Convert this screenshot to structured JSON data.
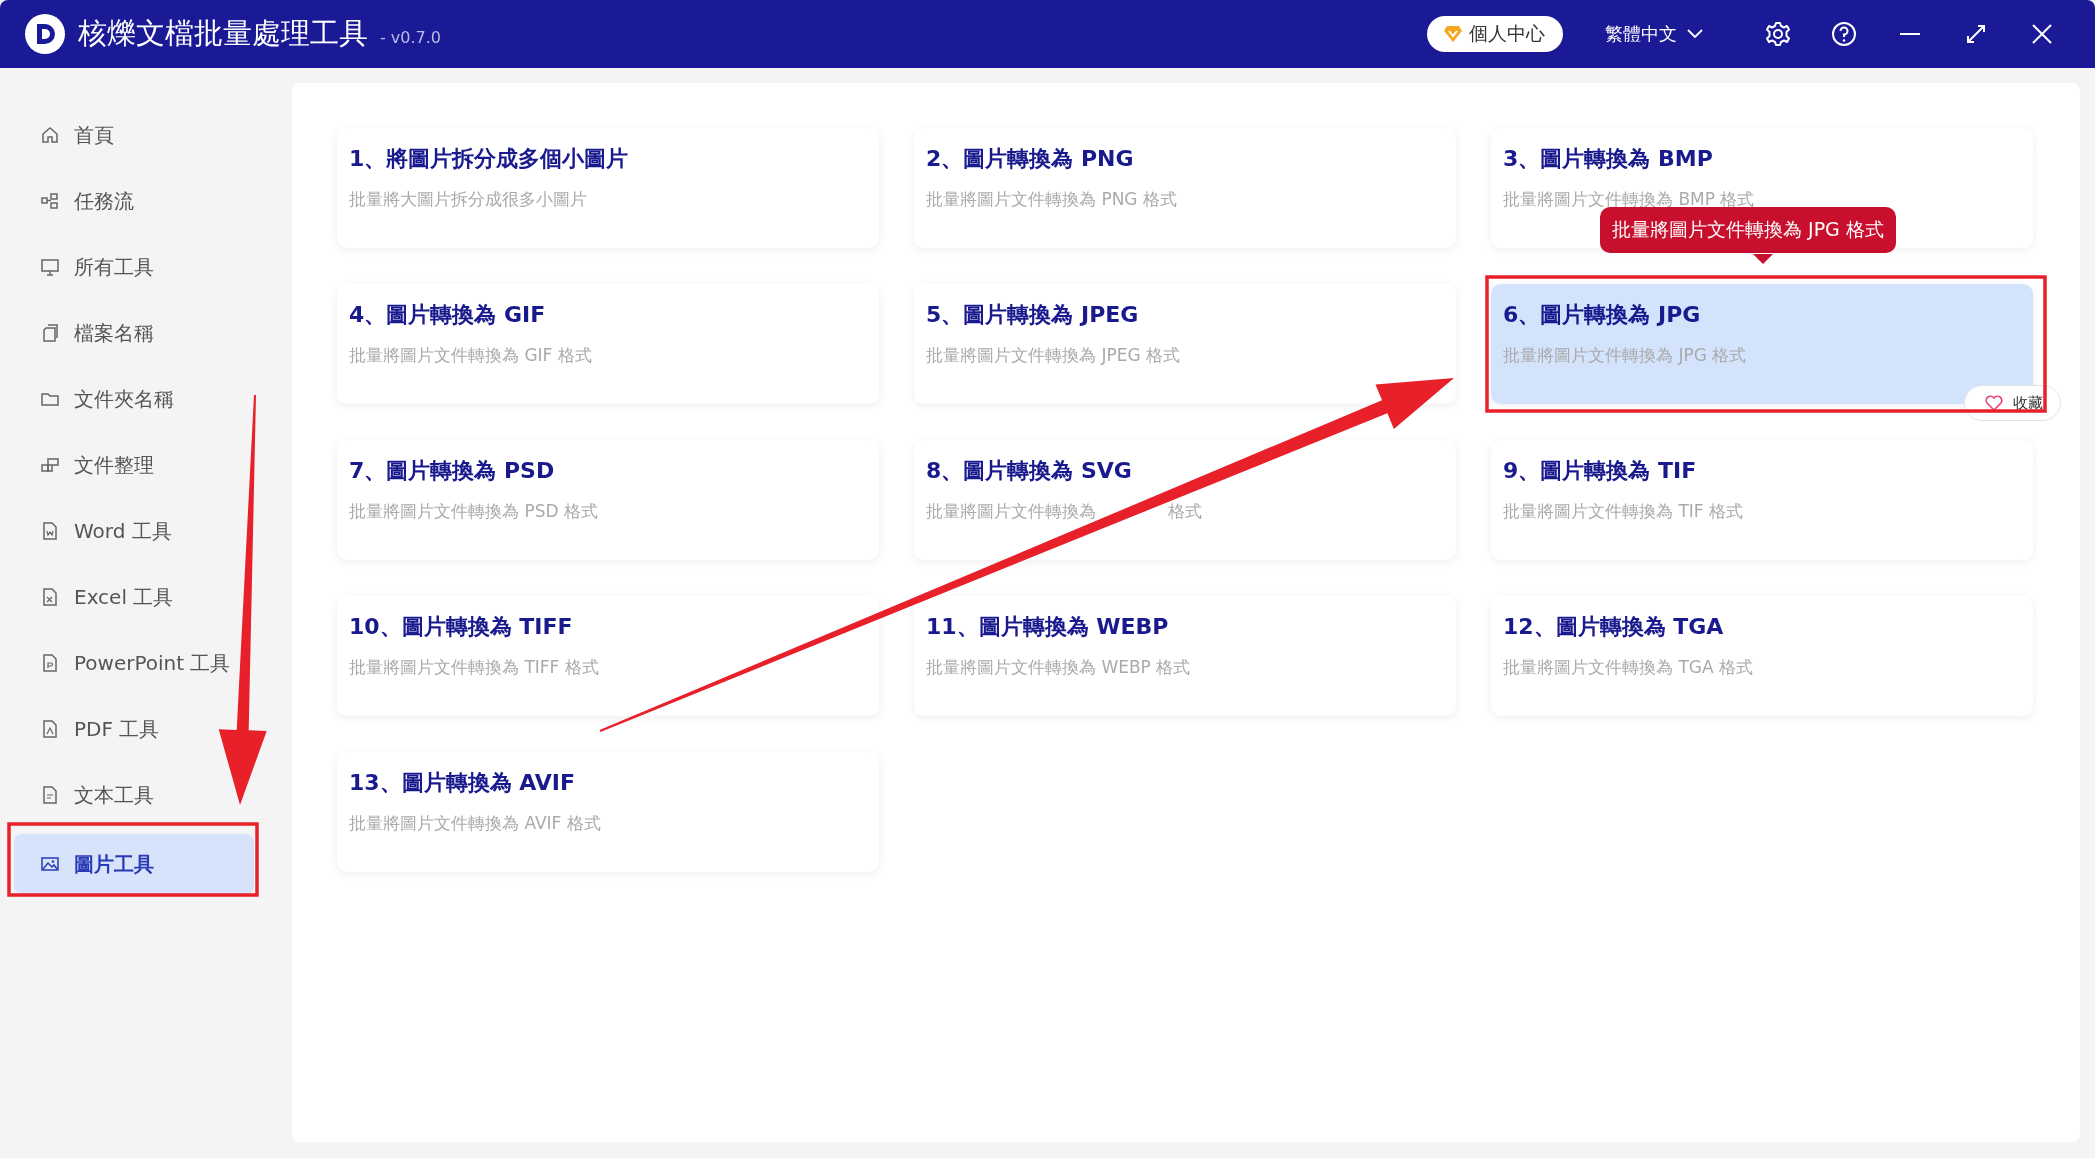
{
  "window": {
    "title": "核爍文檔批量處理工具",
    "version": "- v0.7.0",
    "account_button": "個人中心",
    "language": "繁體中文"
  },
  "sidebar": {
    "items": [
      {
        "label": "首頁",
        "selected": false
      },
      {
        "label": "任務流",
        "selected": false
      },
      {
        "label": "所有工具",
        "selected": false
      },
      {
        "label": "檔案名稱",
        "selected": false
      },
      {
        "label": "文件夾名稱",
        "selected": false
      },
      {
        "label": "文件整理",
        "selected": false
      },
      {
        "label": "Word 工具",
        "selected": false
      },
      {
        "label": "Excel 工具",
        "selected": false
      },
      {
        "label": "PowerPoint 工具",
        "selected": false
      },
      {
        "label": "PDF 工具",
        "selected": false
      },
      {
        "label": "文本工具",
        "selected": false
      },
      {
        "label": "圖片工具",
        "selected": true
      }
    ]
  },
  "tools": [
    {
      "title": "1、將圖片拆分成多個小圖片",
      "description": "批量將大圖片拆分成很多小圖片",
      "highlighted": false
    },
    {
      "title": "2、圖片轉換為 PNG",
      "description": "批量將圖片文件轉換為 PNG 格式",
      "highlighted": false
    },
    {
      "title": "3、圖片轉換為 BMP",
      "description": "批量將圖片文件轉換為 BMP 格式",
      "highlighted": false
    },
    {
      "title": "4、圖片轉換為 GIF",
      "description": "批量將圖片文件轉換為 GIF 格式",
      "highlighted": false
    },
    {
      "title": "5、圖片轉換為 JPEG",
      "description": "批量將圖片文件轉換為 JPEG 格式",
      "highlighted": false
    },
    {
      "title": "6、圖片轉換為 JPG",
      "description": "批量將圖片文件轉換為 JPG 格式",
      "highlighted": true
    },
    {
      "title": "7、圖片轉換為 PSD",
      "description": "批量將圖片文件轉換為 PSD 格式",
      "highlighted": false
    },
    {
      "title": "8、圖片轉換為 SVG",
      "description_segments": [
        "批量將圖片文件轉換為",
        "格式"
      ],
      "highlighted": false
    },
    {
      "title": "9、圖片轉換為 TIF",
      "description": "批量將圖片文件轉換為 TIF 格式",
      "highlighted": false
    },
    {
      "title": "10、圖片轉換為 TIFF",
      "description": "批量將圖片文件轉換為 TIFF 格式",
      "highlighted": false
    },
    {
      "title": "11、圖片轉換為 WEBP",
      "description": "批量將圖片文件轉換為 WEBP 格式",
      "highlighted": false
    },
    {
      "title": "12、圖片轉換為 TGA",
      "description": "批量將圖片文件轉換為 TGA 格式",
      "highlighted": false
    },
    {
      "title": "13、圖片轉換為 AVIF",
      "description": "批量將圖片文件轉換為 AVIF 格式",
      "highlighted": false
    }
  ],
  "hover_tooltip": "批量將圖片文件轉換為 JPG 格式",
  "favorite_button": "收藏"
}
